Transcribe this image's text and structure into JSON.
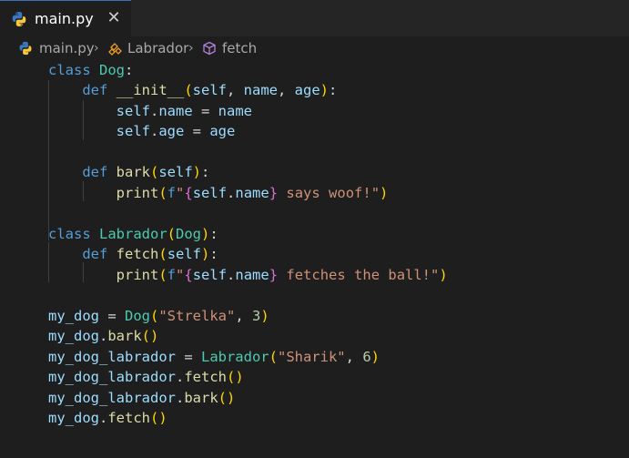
{
  "tab": {
    "title": "main.py",
    "close_glyph": "✕",
    "icon": "python-icon"
  },
  "breadcrumb": {
    "file": "main.py",
    "class": "Labrador",
    "method": "fetch",
    "separator": "›"
  },
  "colors": {
    "keyword": "#569cd6",
    "class": "#4ec9b0",
    "function": "#dcdcaa",
    "variable": "#9cdcfe",
    "string": "#ce9178",
    "number": "#b5cea8"
  },
  "code": [
    [
      [
        "kw",
        "class"
      ],
      [
        "op",
        " "
      ],
      [
        "cls",
        "Dog"
      ],
      [
        "op",
        ":"
      ]
    ],
    [
      [
        "op",
        "    "
      ],
      [
        "kw",
        "def"
      ],
      [
        "op",
        " "
      ],
      [
        "fn",
        "__init__"
      ],
      [
        "br1",
        "("
      ],
      [
        "var",
        "self"
      ],
      [
        "op",
        ", "
      ],
      [
        "var",
        "name"
      ],
      [
        "op",
        ", "
      ],
      [
        "var",
        "age"
      ],
      [
        "br1",
        ")"
      ],
      [
        "op",
        ":"
      ]
    ],
    [
      [
        "op",
        "        "
      ],
      [
        "var",
        "self"
      ],
      [
        "op",
        "."
      ],
      [
        "var",
        "name"
      ],
      [
        "op",
        " = "
      ],
      [
        "var",
        "name"
      ]
    ],
    [
      [
        "op",
        "        "
      ],
      [
        "var",
        "self"
      ],
      [
        "op",
        "."
      ],
      [
        "var",
        "age"
      ],
      [
        "op",
        " = "
      ],
      [
        "var",
        "age"
      ]
    ],
    [],
    [
      [
        "op",
        "    "
      ],
      [
        "kw",
        "def"
      ],
      [
        "op",
        " "
      ],
      [
        "fn",
        "bark"
      ],
      [
        "br1",
        "("
      ],
      [
        "var",
        "self"
      ],
      [
        "br1",
        ")"
      ],
      [
        "op",
        ":"
      ]
    ],
    [
      [
        "op",
        "        "
      ],
      [
        "fn",
        "print"
      ],
      [
        "br1",
        "("
      ],
      [
        "kw",
        "f"
      ],
      [
        "str",
        "\""
      ],
      [
        "br2",
        "{"
      ],
      [
        "var",
        "self"
      ],
      [
        "op",
        "."
      ],
      [
        "var",
        "name"
      ],
      [
        "br2",
        "}"
      ],
      [
        "str",
        " says woof!\""
      ],
      [
        "br1",
        ")"
      ]
    ],
    [],
    [
      [
        "kw",
        "class"
      ],
      [
        "op",
        " "
      ],
      [
        "cls",
        "Labrador"
      ],
      [
        "br1",
        "("
      ],
      [
        "cls",
        "Dog"
      ],
      [
        "br1",
        ")"
      ],
      [
        "op",
        ":"
      ]
    ],
    [
      [
        "op",
        "    "
      ],
      [
        "kw",
        "def"
      ],
      [
        "op",
        " "
      ],
      [
        "fn",
        "fetch"
      ],
      [
        "br1",
        "("
      ],
      [
        "var",
        "self"
      ],
      [
        "br1",
        ")"
      ],
      [
        "op",
        ":"
      ]
    ],
    [
      [
        "op",
        "        "
      ],
      [
        "fn",
        "print"
      ],
      [
        "br1",
        "("
      ],
      [
        "kw",
        "f"
      ],
      [
        "str",
        "\""
      ],
      [
        "br2",
        "{"
      ],
      [
        "var",
        "self"
      ],
      [
        "op",
        "."
      ],
      [
        "var",
        "name"
      ],
      [
        "br2",
        "}"
      ],
      [
        "str",
        " fetches the ball!\""
      ],
      [
        "br1",
        ")"
      ]
    ],
    [],
    [
      [
        "var",
        "my_dog"
      ],
      [
        "op",
        " = "
      ],
      [
        "cls",
        "Dog"
      ],
      [
        "br1",
        "("
      ],
      [
        "str",
        "\"Strelka\""
      ],
      [
        "op",
        ", "
      ],
      [
        "num",
        "3"
      ],
      [
        "br1",
        ")"
      ]
    ],
    [
      [
        "var",
        "my_dog"
      ],
      [
        "op",
        "."
      ],
      [
        "fn",
        "bark"
      ],
      [
        "br1",
        "()"
      ]
    ],
    [
      [
        "var",
        "my_dog_labrador"
      ],
      [
        "op",
        " = "
      ],
      [
        "cls",
        "Labrador"
      ],
      [
        "br1",
        "("
      ],
      [
        "str",
        "\"Sharik\""
      ],
      [
        "op",
        ", "
      ],
      [
        "num",
        "6"
      ],
      [
        "br1",
        ")"
      ]
    ],
    [
      [
        "var",
        "my_dog_labrador"
      ],
      [
        "op",
        "."
      ],
      [
        "fn",
        "fetch"
      ],
      [
        "br1",
        "()"
      ]
    ],
    [
      [
        "var",
        "my_dog_labrador"
      ],
      [
        "op",
        "."
      ],
      [
        "fn",
        "bark"
      ],
      [
        "br1",
        "()"
      ]
    ],
    [
      [
        "var",
        "my_dog"
      ],
      [
        "op",
        "."
      ],
      [
        "fn",
        "fetch"
      ],
      [
        "br1",
        "()"
      ]
    ]
  ]
}
